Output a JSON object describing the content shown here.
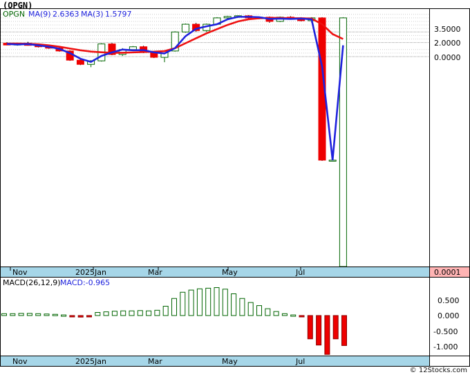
{
  "page_title": "(OPGN)",
  "footer": "© 12Stocks.com",
  "price_panel": {
    "legend": {
      "symbol": "OPGN",
      "ma9_label": "MA(9)",
      "ma9_value": "2.6363",
      "ma3_label": "MA(3)",
      "ma3_value": "1.5797"
    },
    "y_tick_labels": [
      "3.5000",
      "2.0000",
      "0.0000"
    ],
    "last_price_label": "0.0001",
    "x_labels": [
      "Nov",
      "2025Jan",
      "Mar",
      "May",
      "Jul"
    ]
  },
  "macd_panel": {
    "legend": {
      "params": "MACD(26,12,9)",
      "value_text": "MACD:-0.965"
    },
    "y_tick_labels": [
      "0.500",
      "0.000",
      "-0.500",
      "-1.000"
    ],
    "x_labels": [
      "Nov",
      "2025Jan",
      "Mar",
      "May",
      "Jul"
    ]
  },
  "colors": {
    "up": "#006400",
    "down": "#ee0000",
    "ma_long": "#ee1111",
    "ma_short": "#1e22dd",
    "axis_bg": "#a6d6e8",
    "last_price_bg": "#ffb4b4"
  },
  "chart_data": [
    {
      "type": "candlestick",
      "title": "(OPGN)",
      "x_ticks": [
        "Nov",
        "2025Jan",
        "Mar",
        "May",
        "Jul"
      ],
      "y_ticks": [
        3.5,
        2.0,
        0.0
      ],
      "candles": [
        {
          "o": 1.9,
          "h": 2.05,
          "l": 1.6,
          "c": 1.65
        },
        {
          "o": 1.65,
          "h": 1.95,
          "l": 1.55,
          "c": 1.9
        },
        {
          "o": 1.9,
          "h": 2.1,
          "l": 1.55,
          "c": 1.6
        },
        {
          "o": 1.6,
          "h": 1.75,
          "l": 1.3,
          "c": 1.4
        },
        {
          "o": 1.4,
          "h": 1.5,
          "l": 1.1,
          "c": 1.2
        },
        {
          "o": 1.2,
          "h": 1.3,
          "l": 0.7,
          "c": 0.8
        },
        {
          "o": 0.8,
          "h": 0.9,
          "l": -0.6,
          "c": -0.5
        },
        {
          "o": -0.5,
          "h": -0.4,
          "l": -1.2,
          "c": -1.1
        },
        {
          "o": -1.1,
          "h": -0.5,
          "l": -1.5,
          "c": -0.6
        },
        {
          "o": -0.6,
          "h": 1.9,
          "l": -0.7,
          "c": 1.8
        },
        {
          "o": 1.8,
          "h": 1.95,
          "l": 0.2,
          "c": 0.3
        },
        {
          "o": 0.3,
          "h": 1.2,
          "l": 0.1,
          "c": 1.0
        },
        {
          "o": 1.0,
          "h": 1.5,
          "l": 0.9,
          "c": 1.4
        },
        {
          "o": 1.4,
          "h": 1.55,
          "l": 0.5,
          "c": 0.6
        },
        {
          "o": 0.6,
          "h": 0.7,
          "l": -0.2,
          "c": -0.1
        },
        {
          "o": -0.1,
          "h": 0.9,
          "l": -0.8,
          "c": 0.8
        },
        {
          "o": 0.8,
          "h": 3.6,
          "l": 0.7,
          "c": 3.5
        },
        {
          "o": 3.5,
          "h": 4.7,
          "l": 3.4,
          "c": 4.6
        },
        {
          "o": 4.6,
          "h": 4.8,
          "l": 3.5,
          "c": 3.7
        },
        {
          "o": 3.7,
          "h": 4.7,
          "l": 3.5,
          "c": 4.6
        },
        {
          "o": 4.6,
          "h": 5.6,
          "l": 4.5,
          "c": 5.5
        },
        {
          "o": 5.5,
          "h": 5.8,
          "l": 5.3,
          "c": 5.7
        },
        {
          "o": 5.7,
          "h": 5.85,
          "l": 5.5,
          "c": 5.8
        },
        {
          "o": 5.8,
          "h": 5.9,
          "l": 5.4,
          "c": 5.5
        },
        {
          "o": 5.5,
          "h": 5.7,
          "l": 5.3,
          "c": 5.6
        },
        {
          "o": 5.6,
          "h": 5.7,
          "l": 4.8,
          "c": 5.0
        },
        {
          "o": 5.0,
          "h": 5.7,
          "l": 4.9,
          "c": 5.6
        },
        {
          "o": 5.6,
          "h": 5.75,
          "l": 5.4,
          "c": 5.5
        },
        {
          "o": 5.5,
          "h": 5.6,
          "l": 5.0,
          "c": 5.1
        },
        {
          "o": 5.1,
          "h": 5.6,
          "l": 4.8,
          "c": 5.5
        },
        {
          "o": 5.5,
          "h": 5.6,
          "l": -14.8,
          "c": -14.7
        },
        {
          "o": -14.7,
          "h": -14.6,
          "l": -14.8,
          "c": -14.7
        },
        {
          "o": -30.0,
          "h": 5.6,
          "l": -30.5,
          "c": 5.5
        }
      ],
      "series": [
        {
          "name": "MA(9)",
          "values": [
            1.85,
            1.84,
            1.82,
            1.75,
            1.6,
            1.4,
            1.15,
            0.9,
            0.72,
            0.62,
            0.55,
            0.55,
            0.6,
            0.66,
            0.7,
            0.78,
            1.2,
            1.9,
            2.6,
            3.3,
            3.9,
            4.5,
            5.0,
            5.3,
            5.45,
            5.5,
            5.5,
            5.45,
            5.45,
            5.4,
            4.6,
            3.2,
            2.5
          ]
        },
        {
          "name": "MA(3)",
          "values": [
            1.8,
            1.72,
            1.78,
            1.6,
            1.4,
            1.1,
            0.5,
            -0.3,
            -0.75,
            0.1,
            0.6,
            1.0,
            0.9,
            0.93,
            0.6,
            0.45,
            1.2,
            2.9,
            3.95,
            4.3,
            4.6,
            5.3,
            5.65,
            5.65,
            5.6,
            5.35,
            5.4,
            5.35,
            5.4,
            5.3,
            -1.4,
            -14.7,
            1.6
          ]
        }
      ]
    },
    {
      "type": "bar",
      "title": "MACD(26,12,9)",
      "y_ticks": [
        0.5,
        0.0,
        -0.5,
        -1.0
      ],
      "values": [
        0.06,
        0.06,
        0.07,
        0.07,
        0.06,
        0.05,
        0.04,
        0.02,
        -0.03,
        -0.05,
        -0.04,
        0.1,
        0.12,
        0.14,
        0.15,
        0.15,
        0.16,
        0.15,
        0.17,
        0.3,
        0.55,
        0.75,
        0.82,
        0.86,
        0.88,
        0.9,
        0.85,
        0.7,
        0.55,
        0.42,
        0.32,
        0.22,
        0.13,
        0.06,
        0.02,
        -0.04,
        -0.75,
        -0.95,
        -1.25,
        -0.75,
        -0.965
      ]
    }
  ]
}
